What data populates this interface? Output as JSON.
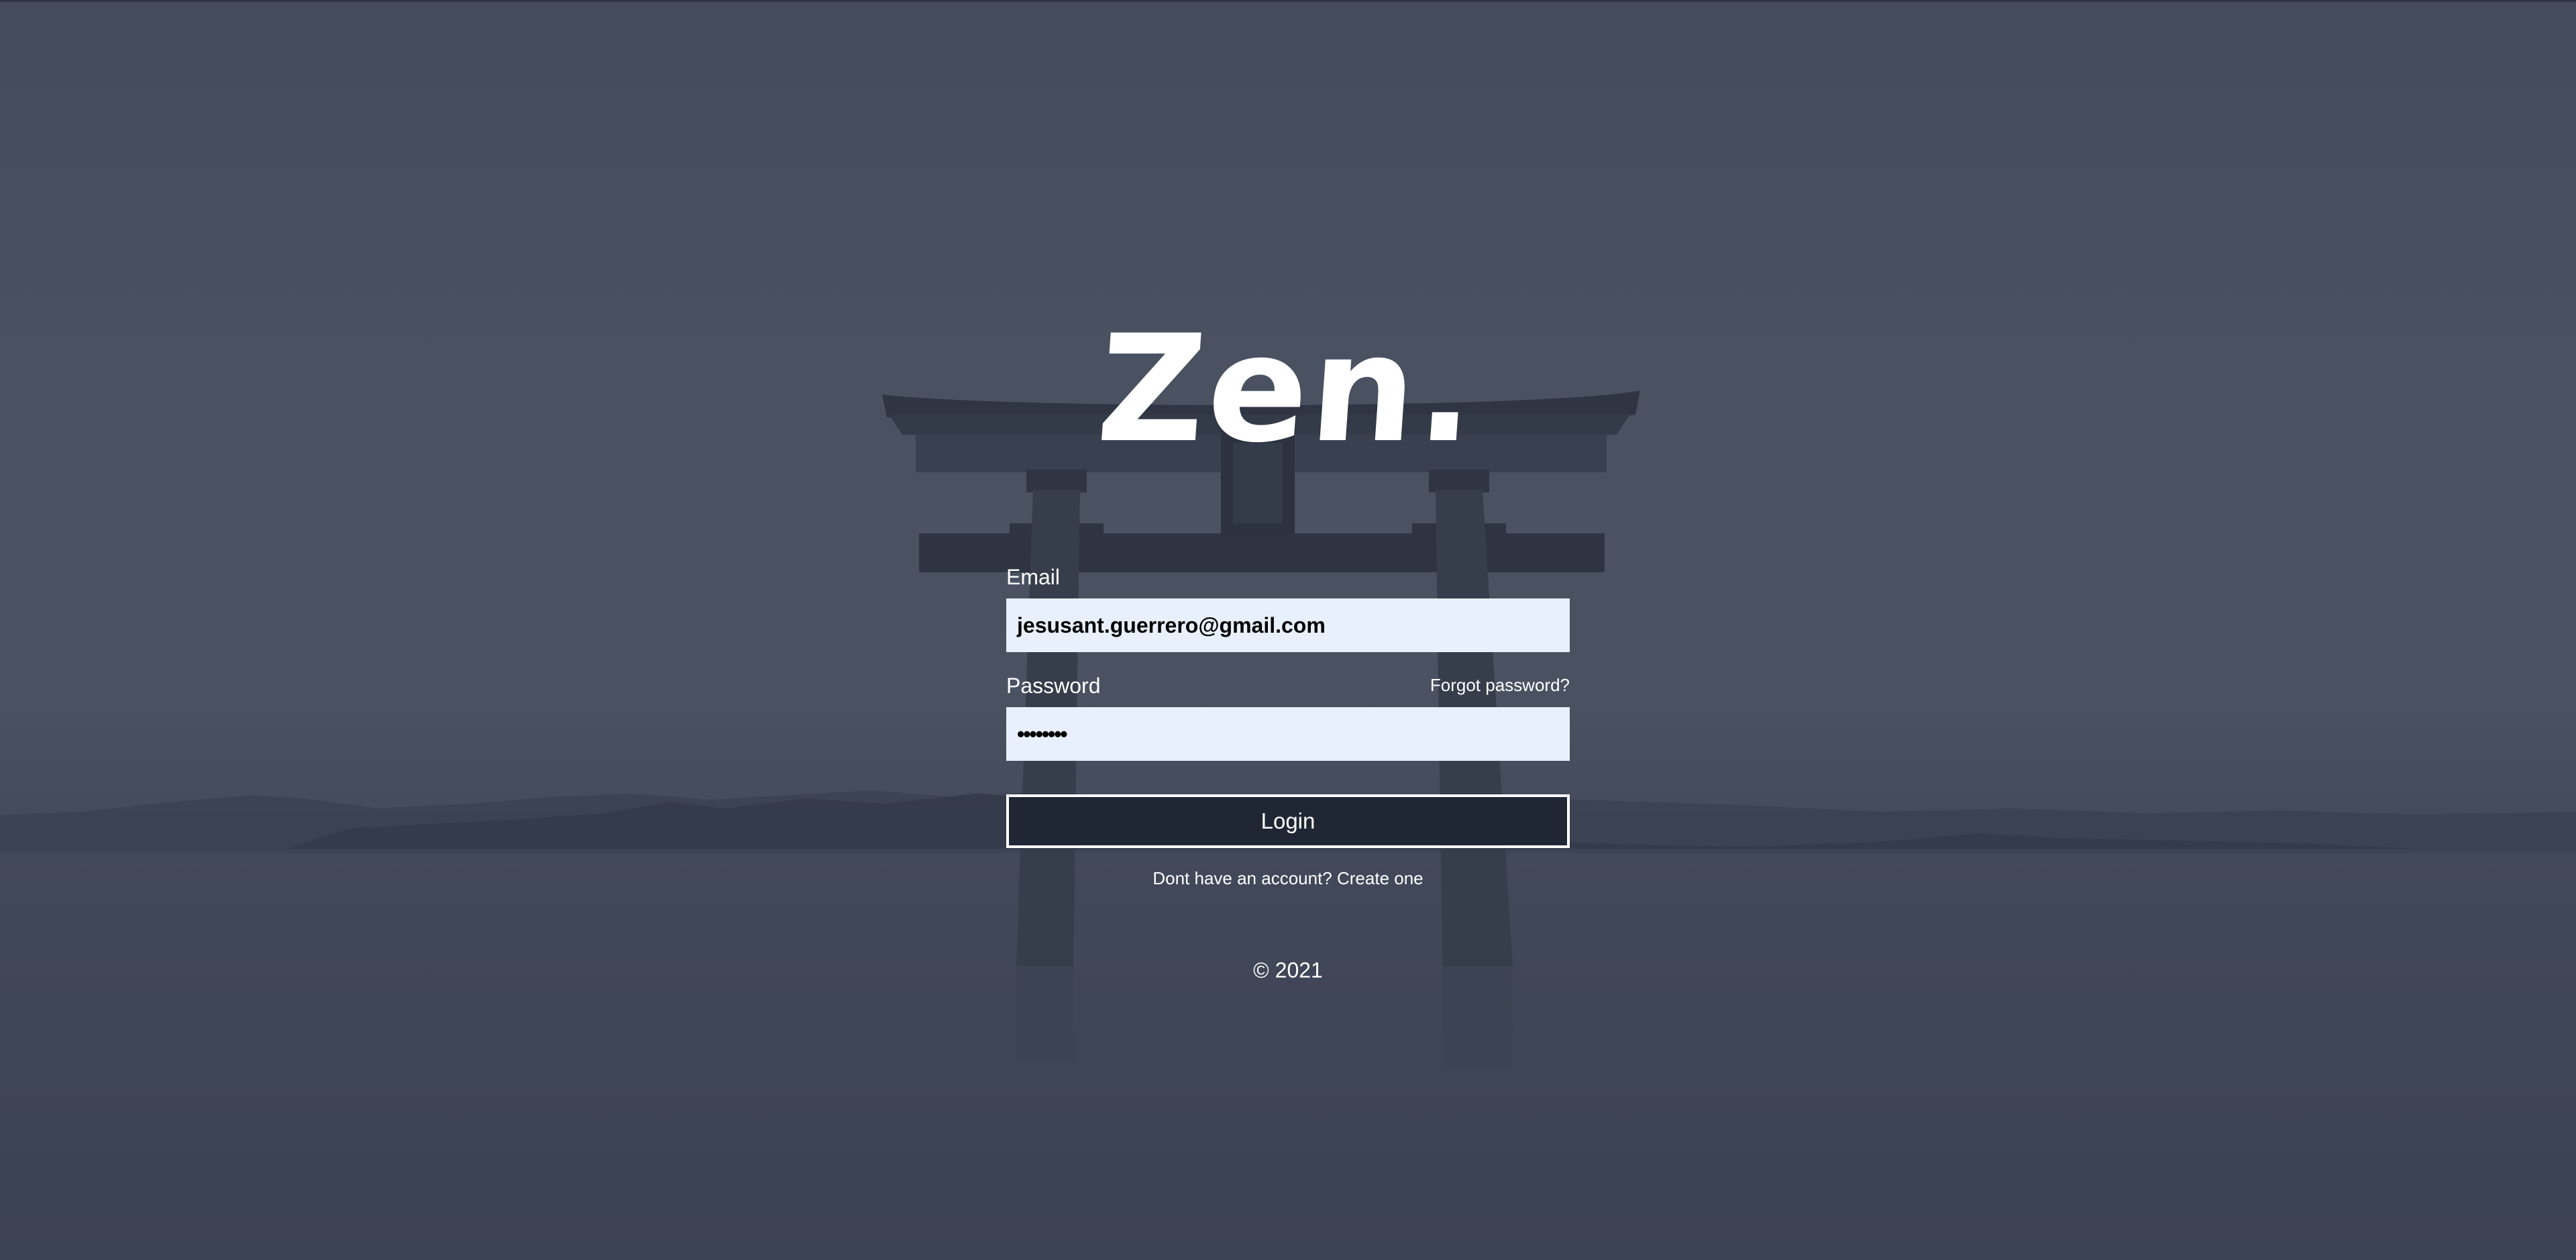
{
  "brand": {
    "logo_text": "Zen."
  },
  "form": {
    "email_label": "Email",
    "email_value": "jesusant.guerrero@gmail.com",
    "password_label": "Password",
    "password_value": "••••••••",
    "forgot_label": "Forgot password?",
    "login_label": "Login",
    "signup_prefix": "Dont have an account?",
    "signup_link": "Create one"
  },
  "footer": {
    "copyright": "© 2021"
  },
  "colors": {
    "background": "#4a5262",
    "input_background": "#e8f0fe",
    "button_background": "#1f2735",
    "text": "#ffffff"
  }
}
